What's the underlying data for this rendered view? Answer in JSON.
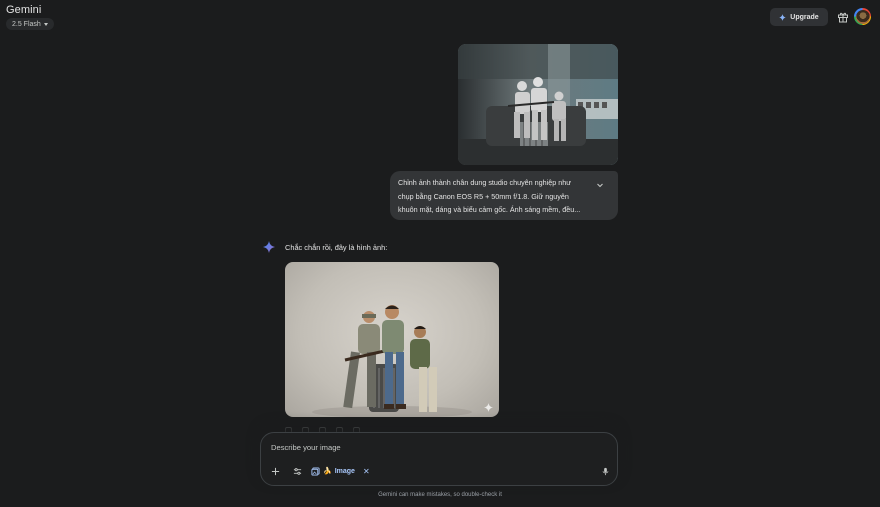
{
  "header": {
    "app_title": "Gemini",
    "model_selector": "2.5 Flash",
    "upgrade_label": "Upgrade"
  },
  "user_message": {
    "lines": [
      "Chỉnh ảnh thành chân dung studio chuyên nghiệp như",
      "chụp bằng Canon EOS R5 + 50mm f/1.8. Giữ nguyên",
      "khuôn mặt, dáng và biểu cảm gốc. Ánh sáng mềm, đều..."
    ]
  },
  "response": {
    "text": "Chắc chắn rồi, đây là hình ảnh:"
  },
  "composer": {
    "placeholder": "Describe your image",
    "tool_chip_label": "Image"
  },
  "footer": {
    "disclaimer": "Gemini can make mistakes, so double-check it"
  },
  "colors": {
    "background": "#1b1c1d",
    "bubble": "#333537",
    "accent_blue": "#a8c7fa",
    "spark_blue": "#4285f4"
  },
  "icons": {
    "upgrade": "sparkle-icon",
    "gift": "gift-icon",
    "expand": "chevron-down-icon",
    "add": "plus-icon",
    "tools": "tune-icon",
    "image_tool": "image-gallery-icon",
    "mic": "microphone-icon"
  }
}
